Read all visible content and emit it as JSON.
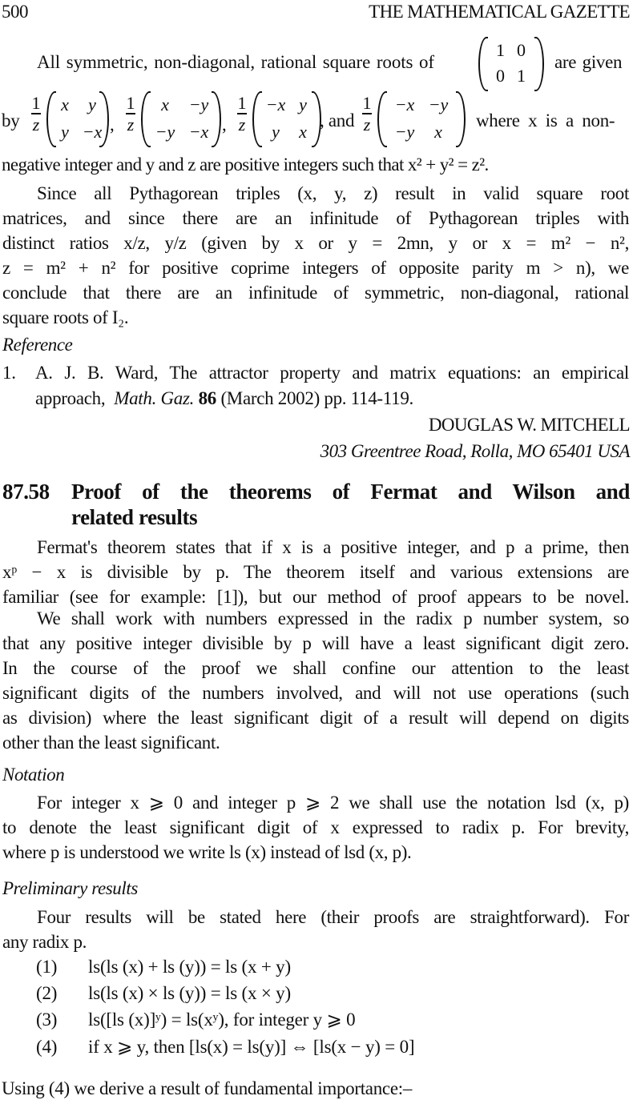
{
  "header": {
    "page_number": "500",
    "journal_title": "THE MATHEMATICAL GAZETTE"
  },
  "intro": {
    "line1_text": "All symmetric, non-diagonal, rational square roots of",
    "line1_tail": "are given",
    "identity_matrix": [
      [
        "1",
        "0"
      ],
      [
        "0",
        "1"
      ]
    ],
    "line2_by": "by",
    "line2_and": ", and",
    "line2_tail": "where x is a non-",
    "fraction": {
      "numerator": "1",
      "denominator": "z"
    },
    "matrices": [
      [
        [
          "x",
          "y"
        ],
        [
          "y",
          "−x"
        ]
      ],
      [
        [
          "x",
          "−y"
        ],
        [
          "−y",
          "−x"
        ]
      ],
      [
        [
          "−x",
          "y"
        ],
        [
          "y",
          "x"
        ]
      ],
      [
        [
          "−x",
          "−y"
        ],
        [
          "−y",
          "x"
        ]
      ]
    ],
    "line3": "negative integer and y and z are positive integers such that x² + y² = z²."
  },
  "paragraph_pythagorean": {
    "lines": [
      "Since all Pythagorean triples (x, y, z) result in valid square root",
      "matrices, and since there are an infinitude of Pythagorean triples with",
      "distinct ratios x/z, y/z (given by x or y = 2mn, y or x = m² − n²,",
      "z = m² + n² for positive coprime integers of opposite parity m > n), we",
      "conclude that there are an infinitude of symmetric, non-diagonal, rational",
      "square roots of I₂."
    ]
  },
  "reference_section": {
    "heading": "Reference",
    "items": [
      {
        "number": "1.",
        "author": "A. J. B. Ward, The attractor property and matrix equations: an empirical",
        "journal": "Math. Gaz.",
        "volume": "86",
        "rest": "(March 2002) pp. 114-119.",
        "prefix": "approach,"
      }
    ]
  },
  "signature": {
    "author": "DOUGLAS W. MITCHELL",
    "address": "303 Greentree Road, Rolla, MO 65401 USA"
  },
  "article": {
    "number": "87.58",
    "title_line1": "Proof of the theorems of Fermat and Wilson and",
    "title_line2": "related results",
    "paragraph1": [
      "Fermat's theorem states that if x is a positive integer, and p a prime, then",
      "xᵖ − x is divisible by p.  The theorem itself and various extensions are",
      "familiar (see for example: [1]), but our method of proof appears to be novel."
    ],
    "paragraph2": [
      "We shall work with numbers expressed in the radix p number system, so",
      "that any positive integer divisible by p will have a least significant digit zero.",
      "In the course of the proof we shall confine our attention to the least",
      "significant digits of the numbers involved, and will not use operations (such",
      "as division) where the least significant digit of a result will depend on digits",
      "other than the least significant."
    ],
    "notation_heading": "Notation",
    "notation_paragraph": [
      "For integer x ⩾ 0 and integer p ⩾ 2 we shall use the notation lsd (x, p)",
      "to denote the least significant digit of x expressed to radix p.  For brevity,",
      "where p is understood we write ls (x) instead of lsd (x, p)."
    ],
    "preliminary_heading": "Preliminary results",
    "preliminary_paragraph": [
      "Four results will be stated here (their proofs are straightforward).  For",
      "any radix p."
    ],
    "results": [
      {
        "label": "(1)",
        "formula": "ls(ls (x) + ls (y)) = ls (x + y)"
      },
      {
        "label": "(2)",
        "formula": "ls(ls (x) × ls (y)) = ls (x × y)"
      },
      {
        "label": "(3)",
        "formula": "ls([ls (x)]ʸ) = ls(xʸ), for integer y ⩾ 0"
      },
      {
        "label": "(4)",
        "formula": "if x ⩾ y, then [ls(x) = ls(y)] ⇔ [ls(x − y) = 0]"
      }
    ],
    "closing_line": "Using (4) we derive a result of fundamental importance:–"
  }
}
